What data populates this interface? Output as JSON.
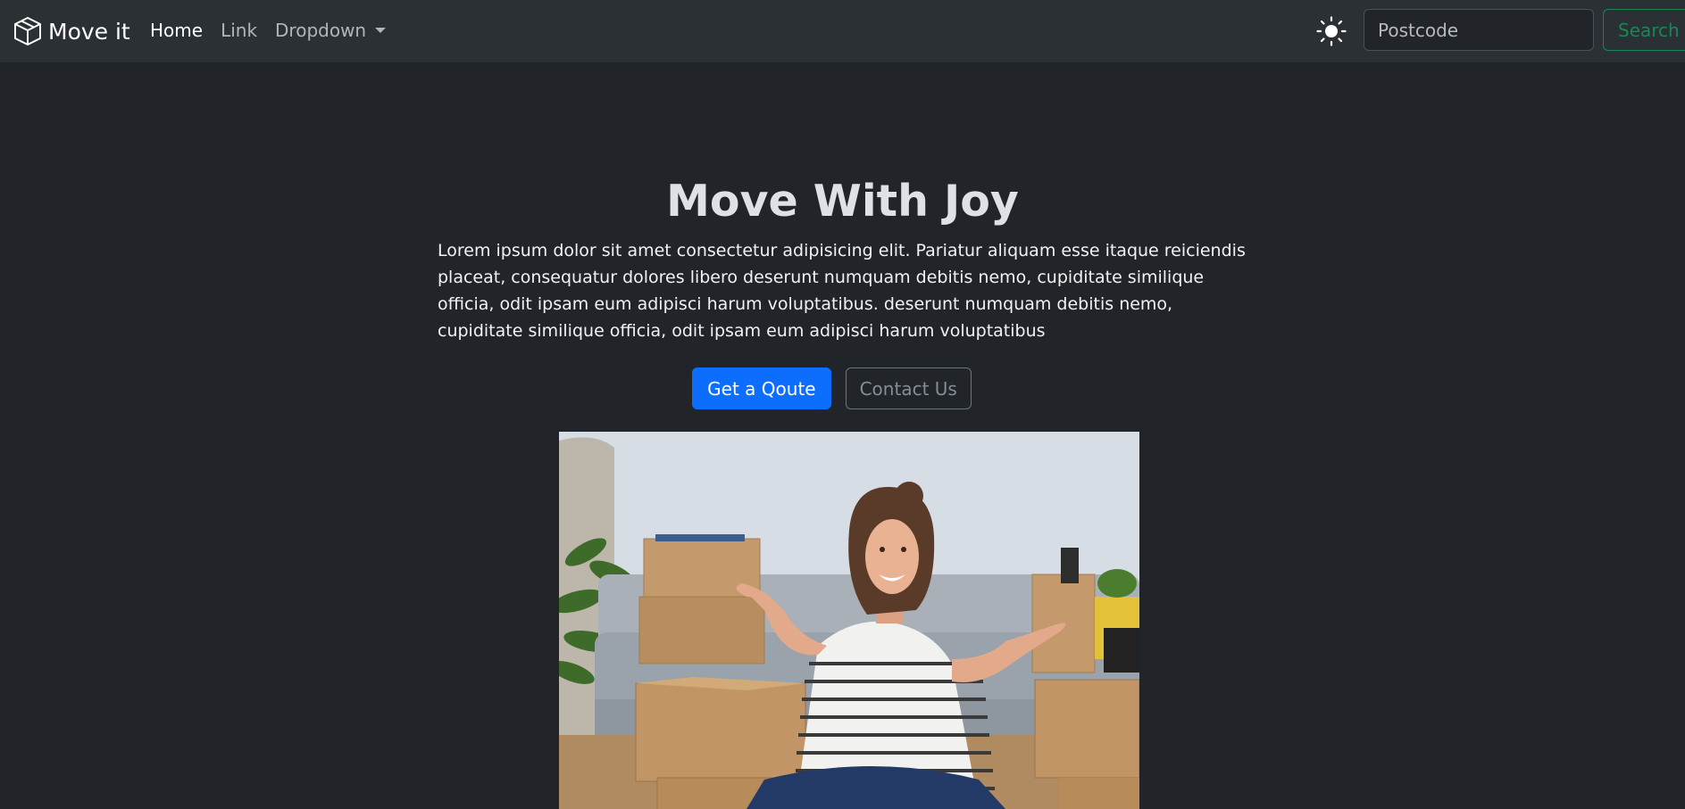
{
  "navbar": {
    "brand": {
      "label": "Move it",
      "icon": "box-icon"
    },
    "links": [
      {
        "label": "Home",
        "active": true
      },
      {
        "label": "Link",
        "active": false
      },
      {
        "label": "Dropdown",
        "active": false,
        "dropdown": true
      }
    ],
    "theme_toggle": {
      "icon": "sun-icon"
    },
    "search": {
      "placeholder": "Postcode",
      "value": "",
      "button_label": "Search"
    }
  },
  "hero": {
    "title": "Move With Joy",
    "lead": "Lorem ipsum dolor sit amet consectetur adipisicing elit. Pariatur aliquam esse itaque reiciendis placeat, consequatur dolores libero deserunt numquam debitis nemo, cupiditate similique officia, odit ipsam eum adipisci harum voluptatibus. deserunt numquam debitis nemo, cupiditate similique officia, odit ipsam eum adipisci harum voluptatibus",
    "primary_button": "Get a Qoute",
    "secondary_button": "Contact Us",
    "image": {
      "subject": "smiling woman sitting among cardboard moving boxes on a floor in front of a grey sofa"
    }
  },
  "colors": {
    "page_bg": "#212529",
    "navbar_bg": "#2b3035",
    "primary": "#0d6efd",
    "success": "#198754",
    "secondary": "#6c757d"
  }
}
